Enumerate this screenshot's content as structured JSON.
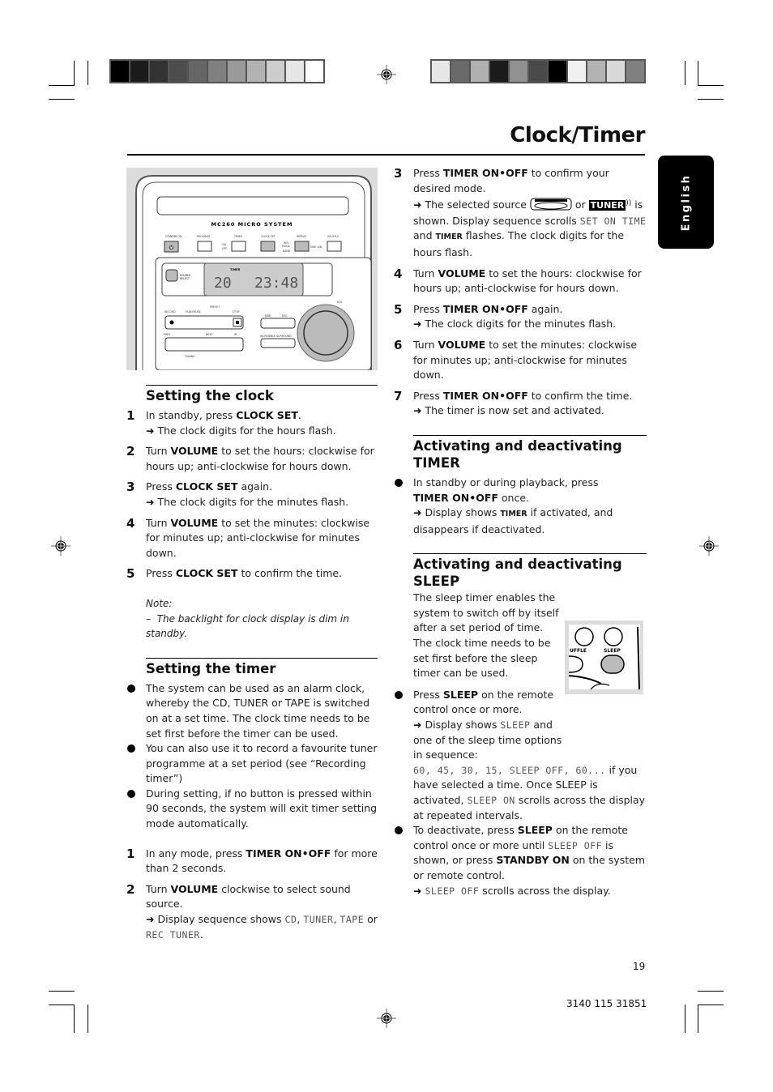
{
  "page": {
    "title": "Clock/Timer",
    "language_tab": "English",
    "page_number": "19",
    "doc_code": "3140 115 31851"
  },
  "color_bars": {
    "left": [
      "#000000",
      "#1b1b1b",
      "#333333",
      "#4d4d4d",
      "#666666",
      "#808080",
      "#999999",
      "#b3b3b3",
      "#cccccc",
      "#e6e6e6",
      "#ffffff"
    ],
    "right": [
      "#e6e6e6",
      "#6a6a6a",
      "#b0b0b0",
      "#1b1b1b",
      "#909090",
      "#4a4a4a",
      "#000000",
      "#f0f0f0",
      "#b3b3b3",
      "#d9d9d9",
      "#808080"
    ]
  },
  "device": {
    "model": "MC260 MICRO SYSTEM",
    "buttons": {
      "standby": "STANDBY-ON",
      "program": "PROGRAM",
      "timer": "TIMER",
      "on_off": "ON OFF",
      "clock_set": "CLOCK SET",
      "rev_mode": "REV MODE",
      "band": "BAND",
      "repeat": "REPEAT",
      "side_ab": "SIDE A/B",
      "shuffle": "SHUFFLE",
      "source_select": "SOURCE SELECT",
      "record": "RECORD",
      "play_pause": "PLAY-PAUSE",
      "preset": "PRESET",
      "stop": "STOP",
      "prev": "PREV",
      "next": "NEXT",
      "ib": "IB",
      "tuning": "TUNING",
      "dbb": "DBB",
      "dsc": "DSC",
      "incredible_surround": "INCREDIBLE SURROUND",
      "vol": "VOL"
    },
    "display": {
      "timer_label": "TIMER",
      "left_digits": "20",
      "right_digits": "23:48"
    }
  },
  "setting_clock": {
    "heading": "Setting the clock",
    "steps": [
      {
        "num": "1",
        "pre": "In standby, press ",
        "bold": "CLOCK SET",
        "post": ".",
        "result": "The clock digits for the hours flash."
      },
      {
        "num": "2",
        "pre": "Turn ",
        "bold": "VOLUME",
        "post": " to set the hours: clockwise for hours up; anti-clockwise for hours down."
      },
      {
        "num": "3",
        "pre": "Press ",
        "bold": "CLOCK SET",
        "post": " again.",
        "result": "The clock digits for the minutes flash."
      },
      {
        "num": "4",
        "pre": "Turn ",
        "bold": "VOLUME",
        "post": " to set the minutes: clockwise for minutes up; anti-clockwise for minutes down."
      },
      {
        "num": "5",
        "pre": "Press ",
        "bold": "CLOCK SET",
        "post": " to confirm the time."
      }
    ],
    "note_label": "Note:",
    "note_text": "The backlight for clock display is dim in standby."
  },
  "setting_timer": {
    "heading": "Setting the timer",
    "bullets": [
      "The system can be used as an alarm clock, whereby the CD, TUNER or TAPE is switched on at a set time. The clock time needs to be set first before the timer can be used.",
      "You can also use it to record a favourite tuner programme at a set period (see “Recording timer”)",
      "During setting, if no button is pressed within 90 seconds, the system will exit timer setting mode automatically."
    ],
    "step1": {
      "num": "1",
      "pre": "In any mode, press ",
      "bold": "TIMER ON•OFF",
      "post": " for more than 2 seconds."
    },
    "step2": {
      "num": "2",
      "pre": "Turn ",
      "bold": "VOLUME",
      "post": " clockwise to select sound source.",
      "result_pre": "Display sequence shows ",
      "lcd1": "CD",
      "lcd2": "TUNER",
      "lcd3": "TAPE",
      "or": " or ",
      "lcd4": "REC TUNER"
    },
    "step3": {
      "num": "3",
      "pre": "Press ",
      "bold": "TIMER ON•OFF",
      "post": " to confirm your desired mode.",
      "result_pre": "The selected source ",
      "or": " or ",
      "tuner_badge": "TUNER",
      "result_mid": " is shown. Display sequence scrolls ",
      "lcd": "SET ON TIME",
      "and": " and ",
      "timer_sc": "TIMER",
      "result_post": " flashes. The clock digits for the hours flash."
    },
    "step4": {
      "num": "4",
      "pre": "Turn ",
      "bold": "VOLUME",
      "post": " to set the hours: clockwise for hours up; anti-clockwise for hours down."
    },
    "step5": {
      "num": "5",
      "pre": "Press ",
      "bold": "TIMER ON•OFF",
      "post": " again.",
      "result": "The clock digits for the minutes flash."
    },
    "step6": {
      "num": "6",
      "pre": "Turn ",
      "bold": "VOLUME",
      "post": " to set the minutes: clockwise for minutes up; anti-clockwise for minutes down."
    },
    "step7": {
      "num": "7",
      "pre": "Press ",
      "bold": "TIMER ON•OFF",
      "post": " to confirm the time.",
      "result": "The timer is now set and activated."
    }
  },
  "activate_timer": {
    "heading_line1": "Activating and deactivating",
    "heading_line2": "TIMER",
    "pre": "In standby or during playback, press ",
    "bold": "TIMER ON•OFF",
    "post": " once.",
    "result_pre": "Display shows ",
    "timer_sc": "TIMER",
    "result_post": " if activated, and disappears if deactivated."
  },
  "activate_sleep": {
    "heading_line1": "Activating and deactivating",
    "heading_line2": "SLEEP",
    "intro": "The sleep timer enables the system to switch off by itself after a set period of time. The clock time needs to be set first before the sleep timer can be used.",
    "b1_pre": "Press ",
    "b1_bold": "SLEEP",
    "b1_post": " on the remote control once or more.",
    "b1_result_pre": "Display shows ",
    "b1_lcd": "SLEEP",
    "b1_result_mid": " and one of the sleep time options in sequence: ",
    "b1_options": "60, 45, 30, 15, SLEEP OFF, 60...",
    "b1_result_mid2": " if you have selected a time. Once SLEEP is activated, ",
    "b1_lcd2": "SLEEP ON",
    "b1_result_post": " scrolls across the display at repeated intervals.",
    "b2_pre": "To deactivate, press ",
    "b2_bold": "SLEEP",
    "b2_mid": " on the remote control once or more until ",
    "b2_lcd": "SLEEP OFF",
    "b2_mid2": " is shown, or press ",
    "b2_bold2": "STANDBY ON",
    "b2_post": " on the system or remote control.",
    "b2_result_lcd": "SLEEP OFF",
    "b2_result_post": " scrolls across the display.",
    "remote_labels": {
      "shuffle": "UFFLE",
      "sleep": "SLEEP"
    }
  }
}
